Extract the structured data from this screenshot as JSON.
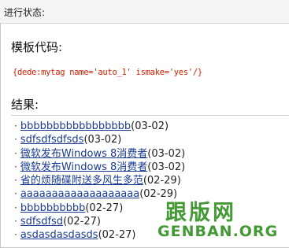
{
  "status": {
    "label": "进行状态:"
  },
  "template": {
    "heading": "模板代码:",
    "code": "{dede:mytag name='auto_1' ismake='yes'/}"
  },
  "result": {
    "heading": "结果:",
    "items": [
      {
        "title": "bbbbbbbbbbbbbbbbb",
        "date": "(03-02)"
      },
      {
        "title": "sdfsdfsdfsds",
        "date": "(03-02)"
      },
      {
        "title": "微软发布Windows 8消费者",
        "date": "(03-02)"
      },
      {
        "title": "微软发布Windows 8消费者",
        "date": "(03-02)"
      },
      {
        "title": "省的烦随碟附送多风生多范",
        "date": "(02-29)"
      },
      {
        "title": "aaaaaaaaaaaaaaaaaaa",
        "date": "(02-29)"
      },
      {
        "title": "bbbbbbbbbb",
        "date": "(02-27)"
      },
      {
        "title": "sdfsdfsd",
        "date": "(02-27)"
      },
      {
        "title": "asdasdasdasds",
        "date": "(02-27)"
      }
    ]
  },
  "watermark": {
    "cn": "跟版网",
    "en": "GENBAN.ORG"
  }
}
